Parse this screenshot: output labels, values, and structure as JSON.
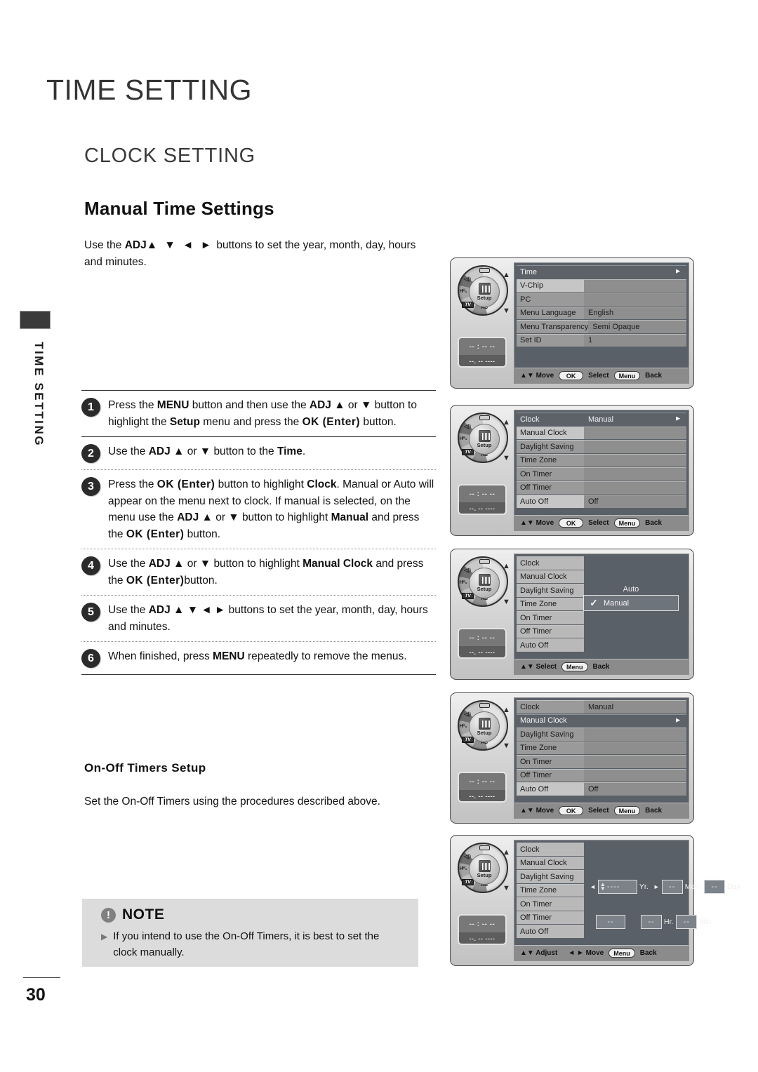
{
  "chapter_title": "TIME SETTING",
  "section_title": "CLOCK SETTING",
  "subsection_title": "Manual Time Settings",
  "side_tab_label": "TIME SETTING",
  "page_number": "30",
  "intro": {
    "part1": "Use the ",
    "adj": "ADJ",
    "arrows": "▲ ▼ ◄ ►",
    "part2": " buttons to set the year, month, day, hours and minutes."
  },
  "steps": [
    {
      "num": "1",
      "html": "Press the <b>MENU</b> button and then use the <b>ADJ</b> ▲ or ▼ button to highlight the <b>Setup</b> menu and press the <b class=\"mono\">OK (Enter)</b> button."
    },
    {
      "num": "2",
      "html": "Use the <b>ADJ</b> ▲ or ▼ button to the <b>Time</b>."
    },
    {
      "num": "3",
      "html": "Press the <b class=\"mono\">OK (Enter)</b> button to highlight <b>Clock</b>. Manual or Auto will appear on the menu next to clock. If manual is selected, on the menu use the <b>ADJ</b> ▲ or ▼ button to highlight <b>Manual</b> and press the <b class=\"mono\">OK (Enter)</b> button."
    },
    {
      "num": "4",
      "html": "Use the <b>ADJ</b> ▲ or ▼ button to highlight <b>Manual Clock</b> and press the <b class=\"mono\">OK (Enter)</b>button."
    },
    {
      "num": "5",
      "html": "Use the <b>ADJ</b> ▲ ▼ ◄ ► buttons to set the year, month, day, hours and minutes."
    },
    {
      "num": "6",
      "html": "When finished, press <b>MENU</b> repeatedly to remove the menus."
    }
  ],
  "timers": {
    "heading": "On-Off Timers Setup",
    "body": "Set the On-Off Timers using the procedures described above."
  },
  "note": {
    "icon": "!",
    "title": "NOTE",
    "bullet": "▶",
    "text": "If you intend to use the On-Off Timers, it is best to set the clock manually."
  },
  "remote": {
    "setup_label": "Setup",
    "seg_volume": "◁))",
    "seg_eq": "Hᴴ₁",
    "seg_tv": "TV",
    "seg_ab": "AB",
    "arrow_up": "▲",
    "arrow_down": "▼",
    "display_line1": "-- : -- --",
    "display_line2": "--. --  ----"
  },
  "hints": {
    "move": "Move",
    "select": "Select",
    "back": "Back",
    "adjust": "Adjust",
    "ok": "OK",
    "menu": "Menu",
    "updown": "▲▼",
    "leftright": "◄ ►",
    "caret": "►"
  },
  "panels": [
    {
      "id": "panel-setup-menu",
      "rows": [
        {
          "label": "Time",
          "value": "",
          "selected": true,
          "caret": true,
          "lightlab": false
        },
        {
          "label": "V-Chip",
          "value": "",
          "selected": false,
          "caret": false,
          "lightlab": true
        },
        {
          "label": "PC",
          "value": "",
          "selected": false,
          "caret": false,
          "lightlab": false
        },
        {
          "label": "Menu Language",
          "value": "English",
          "selected": false,
          "caret": false,
          "lightlab": false
        },
        {
          "label": "Menu Transparency",
          "value": "Semi Opaque",
          "selected": false,
          "caret": false,
          "lightlab": false
        },
        {
          "label": "Set ID",
          "value": "1",
          "selected": false,
          "caret": false,
          "lightlab": false
        }
      ],
      "hint_style": "move-ok-menu"
    },
    {
      "id": "panel-time-menu",
      "rows": [
        {
          "label": "Clock",
          "value": "Manual",
          "selected": true,
          "caret": true,
          "lightlab": false
        },
        {
          "label": "Manual Clock",
          "value": "",
          "selected": false,
          "caret": false,
          "lightlab": true
        },
        {
          "label": "Daylight Saving",
          "value": "",
          "selected": false,
          "caret": false,
          "lightlab": false
        },
        {
          "label": "Time Zone",
          "value": "",
          "selected": false,
          "caret": false,
          "lightlab": false
        },
        {
          "label": "On Timer",
          "value": "",
          "selected": false,
          "caret": false,
          "lightlab": false
        },
        {
          "label": "Off Timer",
          "value": "",
          "selected": false,
          "caret": false,
          "lightlab": false
        },
        {
          "label": "Auto Off",
          "value": "Off",
          "selected": false,
          "caret": false,
          "lightlab": true
        }
      ],
      "hint_style": "move-ok-menu"
    },
    {
      "id": "panel-clock-popup",
      "rows": [
        {
          "label": "Clock",
          "value": "",
          "selected": false,
          "caret": false,
          "lightlab": true
        },
        {
          "label": "Manual Clock",
          "value": "",
          "selected": false,
          "caret": false,
          "lightlab": false
        },
        {
          "label": "Daylight Saving",
          "value": "",
          "selected": false,
          "caret": false,
          "lightlab": false
        },
        {
          "label": "Time Zone",
          "value": "",
          "selected": false,
          "caret": false,
          "lightlab": false
        },
        {
          "label": "On Timer",
          "value": "",
          "selected": false,
          "caret": false,
          "lightlab": false
        },
        {
          "label": "Off Timer",
          "value": "",
          "selected": false,
          "caret": false,
          "lightlab": false
        },
        {
          "label": "Auto Off",
          "value": "",
          "selected": false,
          "caret": false,
          "lightlab": true
        }
      ],
      "popup": {
        "auto_label": "Auto",
        "manual_label": "Manual",
        "check": "✓"
      },
      "hint_style": "select-menu"
    },
    {
      "id": "panel-manual-clock-selected",
      "rows": [
        {
          "label": "Clock",
          "value": "Manual",
          "selected": false,
          "caret": false,
          "lightlab": false
        },
        {
          "label": "Manual Clock",
          "value": "",
          "selected": true,
          "caret": true,
          "lightlab": false
        },
        {
          "label": "Daylight Saving",
          "value": "",
          "selected": false,
          "caret": false,
          "lightlab": false
        },
        {
          "label": "Time Zone",
          "value": "",
          "selected": false,
          "caret": false,
          "lightlab": false
        },
        {
          "label": "On Timer",
          "value": "",
          "selected": false,
          "caret": false,
          "lightlab": false
        },
        {
          "label": "Off Timer",
          "value": "",
          "selected": false,
          "caret": false,
          "lightlab": false
        },
        {
          "label": "Auto Off",
          "value": "Off",
          "selected": false,
          "caret": false,
          "lightlab": true
        }
      ],
      "hint_style": "move-ok-menu"
    },
    {
      "id": "panel-date-entry",
      "rows": [
        {
          "label": "Clock",
          "value": "",
          "selected": false,
          "caret": false,
          "lightlab": true
        },
        {
          "label": "Manual Clock",
          "value": "",
          "selected": false,
          "caret": false,
          "lightlab": false
        },
        {
          "label": "Daylight Saving",
          "value": "",
          "selected": false,
          "caret": false,
          "lightlab": false
        },
        {
          "label": "Time Zone",
          "value": "",
          "selected": false,
          "caret": false,
          "lightlab": false
        },
        {
          "label": "On Timer",
          "value": "",
          "selected": false,
          "caret": false,
          "lightlab": false
        },
        {
          "label": "Off Timer",
          "value": "",
          "selected": false,
          "caret": false,
          "lightlab": false
        },
        {
          "label": "Auto Off",
          "value": "",
          "selected": false,
          "caret": false,
          "lightlab": true
        }
      ],
      "date_fields": {
        "left_arrow": "◄",
        "right_arrow": "►",
        "year_value": "----",
        "year_unit": "Yr.",
        "month_value": "--",
        "month_unit": "Mon.",
        "day_value": "--",
        "day_unit": "Day",
        "ampm_value": "--",
        "hour_value": "--",
        "hour_unit": "Hr.",
        "minute_value": "--",
        "minute_unit": "Min.",
        "spin_up": "▲",
        "spin_down": "▼"
      },
      "hint_style": "adjust-move-menu"
    }
  ]
}
